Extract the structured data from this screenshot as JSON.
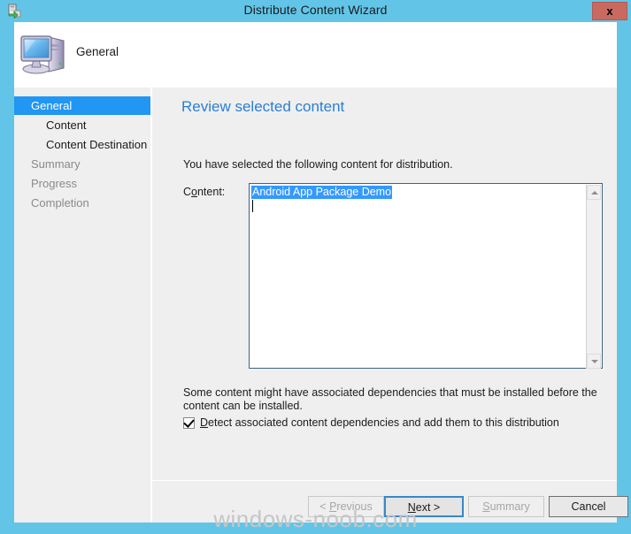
{
  "window": {
    "title": "Distribute Content Wizard",
    "icon": "distribute-content-icon",
    "close_label": "x",
    "frame_color": "#62c5e8",
    "titlebar_color": "#62c5e8",
    "close_button_color": "#c96a60"
  },
  "header": {
    "step_label": "General",
    "icon": "computer-icon"
  },
  "sidebar": {
    "items": [
      {
        "label": "General",
        "state": "selected",
        "indent": 0
      },
      {
        "label": "Content",
        "state": "normal",
        "indent": 1
      },
      {
        "label": "Content Destination",
        "state": "normal",
        "indent": 1
      },
      {
        "label": "Summary",
        "state": "dim",
        "indent": 0
      },
      {
        "label": "Progress",
        "state": "dim",
        "indent": 0
      },
      {
        "label": "Completion",
        "state": "dim",
        "indent": 0
      }
    ],
    "selected_color": "#2196f3"
  },
  "main": {
    "page_title": "Review selected content",
    "page_title_color": "#2a7fd4",
    "intro_text": "You have selected the following content for distribution.",
    "content_label_pre": "C",
    "content_label_accel": "o",
    "content_label_post": "ntent:",
    "listbox": {
      "items": [
        "Android App Package Demo"
      ],
      "selected_index": 0,
      "selection_color": "#3399ff",
      "scrollbar": {
        "up_icon": "chevron-up-icon",
        "down_icon": "chevron-down-icon"
      }
    },
    "note_text": "Some content might have associated dependencies that must be installed before the content can be installed.",
    "checkbox": {
      "checked": true,
      "label_pre": "",
      "label_accel": "D",
      "label_post": "etect associated content dependencies and add them to this distribution"
    }
  },
  "footer": {
    "buttons": [
      {
        "pre": "< ",
        "accel": "P",
        "post": "revious",
        "state": "disabled"
      },
      {
        "pre": "",
        "accel": "N",
        "post": "ext >",
        "state": "focused"
      },
      {
        "pre": "",
        "accel": "S",
        "post": "ummary",
        "state": "disabled"
      },
      {
        "pre": "",
        "accel": "",
        "post": "Cancel",
        "state": "normal"
      }
    ]
  },
  "watermark": {
    "text": "windows-noob.com"
  }
}
